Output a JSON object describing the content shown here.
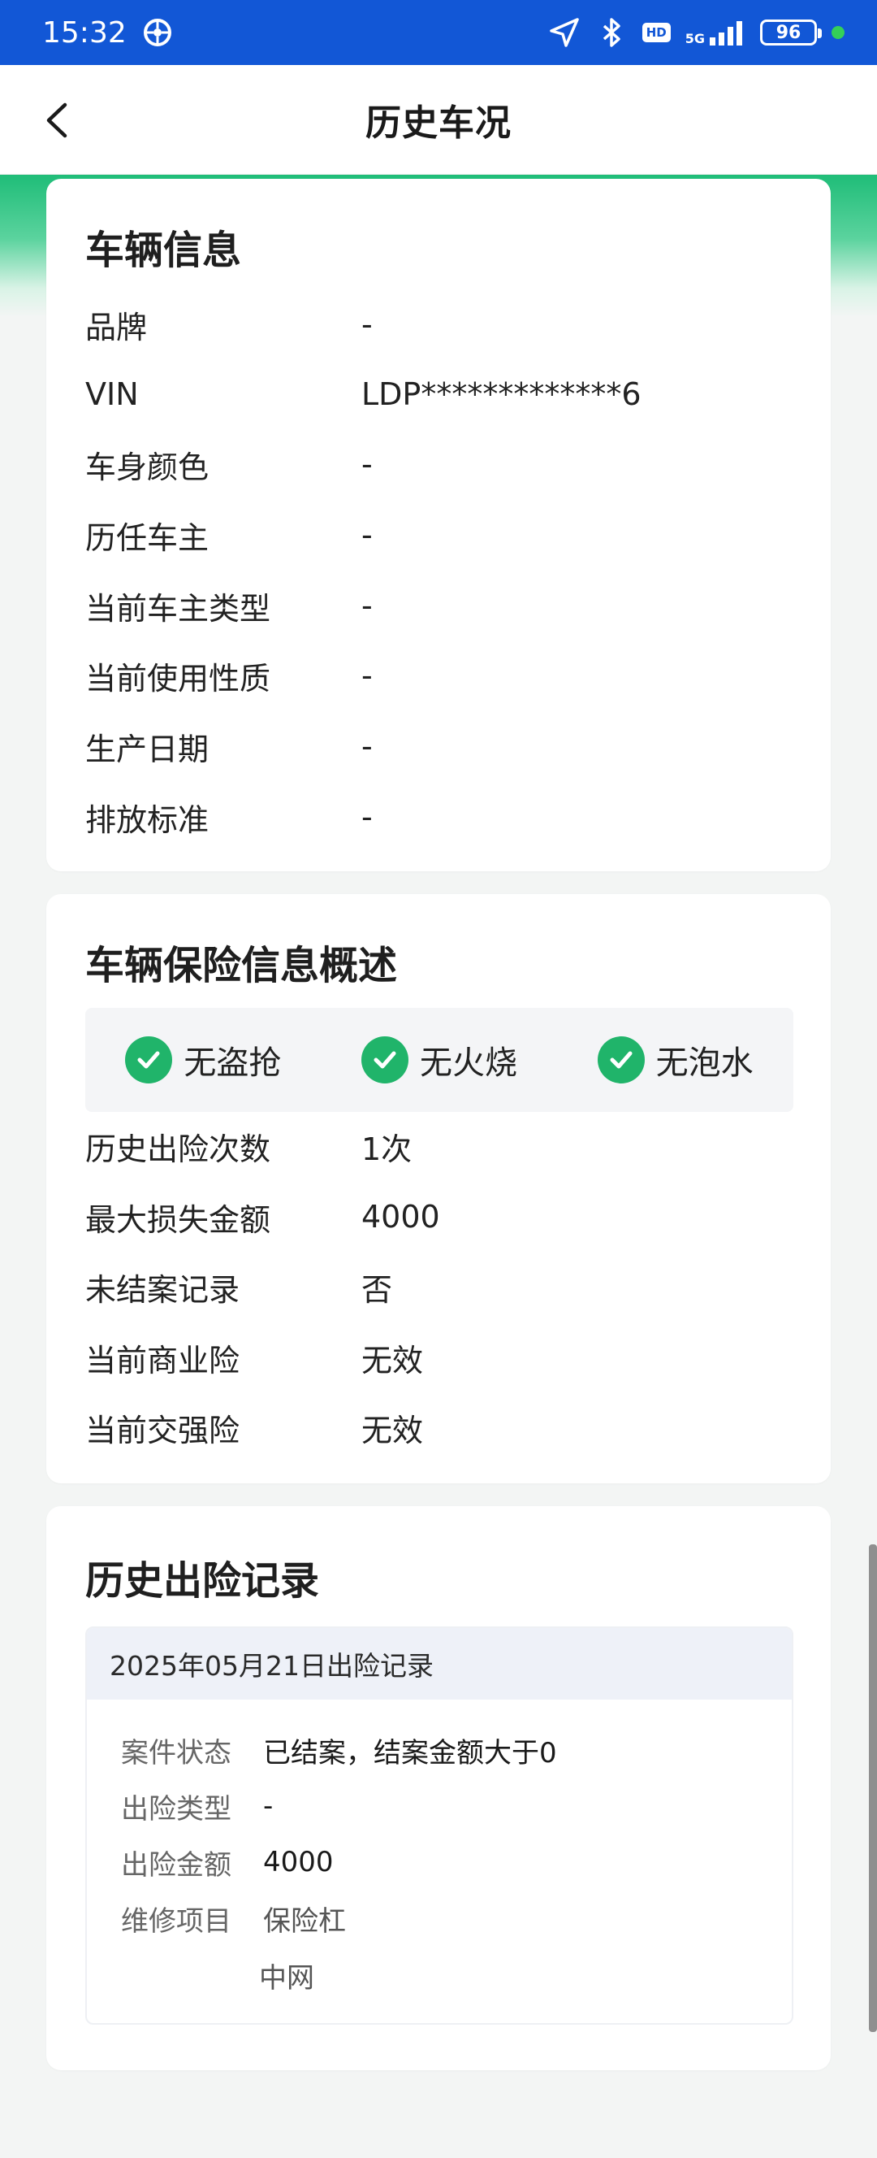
{
  "status_bar": {
    "time": "15:32",
    "network": "5G",
    "hd": "HD",
    "battery": "96"
  },
  "header": {
    "title": "历史车况"
  },
  "vehicle_info": {
    "title": "车辆信息",
    "rows": [
      {
        "label": "品牌",
        "value": "-"
      },
      {
        "label": "VIN",
        "value": "LDP*************6"
      },
      {
        "label": "车身颜色",
        "value": "-"
      },
      {
        "label": "历任车主",
        "value": "-"
      },
      {
        "label": "当前车主类型",
        "value": "-"
      },
      {
        "label": "当前使用性质",
        "value": "-"
      },
      {
        "label": "生产日期",
        "value": "-"
      },
      {
        "label": "排放标准",
        "value": "-"
      }
    ]
  },
  "insurance_overview": {
    "title": "车辆保险信息概述",
    "badges": [
      "无盗抢",
      "无火烧",
      "无泡水"
    ],
    "rows": [
      {
        "label": "历史出险次数",
        "value": "1次"
      },
      {
        "label": "最大损失金额",
        "value": "4000"
      },
      {
        "label": "未结案记录",
        "value": "否"
      },
      {
        "label": "当前商业险",
        "value": "无效"
      },
      {
        "label": "当前交强险",
        "value": "无效"
      }
    ]
  },
  "claim_history": {
    "title": "历史出险记录",
    "records": [
      {
        "header": "2025年05月21日出险记录",
        "rows": [
          {
            "label": "案件状态",
            "value": "已结案，结案金额大于0"
          },
          {
            "label": "出险类型",
            "value": "-"
          },
          {
            "label": "出险金额",
            "value": "4000"
          },
          {
            "label": "维修项目",
            "value": "保险杠"
          }
        ],
        "extra_items": [
          "中网"
        ]
      }
    ]
  }
}
